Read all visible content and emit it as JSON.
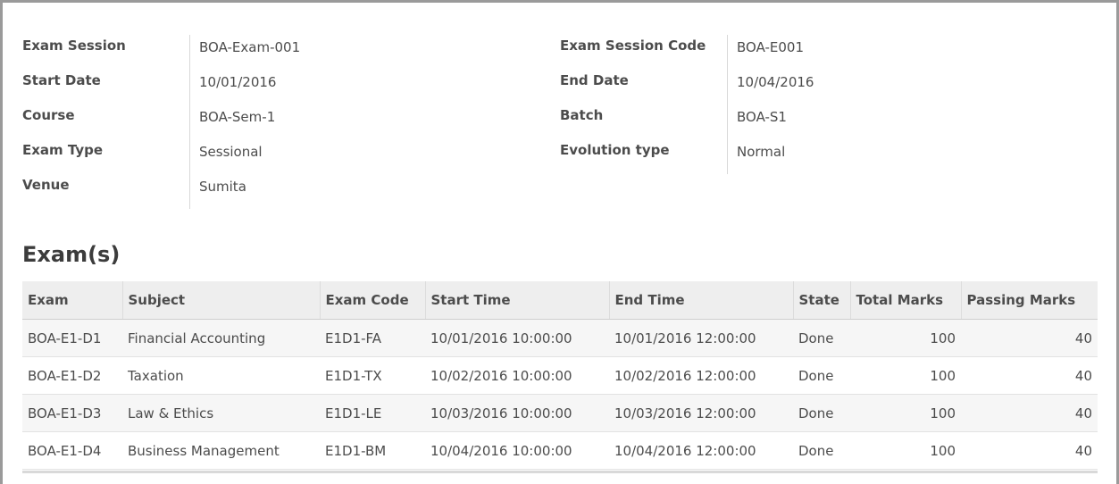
{
  "session": {
    "left": [
      {
        "label": "Exam Session",
        "value": "BOA-Exam-001"
      },
      {
        "label": "Start Date",
        "value": "10/01/2016"
      },
      {
        "label": "Course",
        "value": "BOA-Sem-1"
      },
      {
        "label": "Exam Type",
        "value": "Sessional"
      },
      {
        "label": "Venue",
        "value": "Sumita"
      }
    ],
    "right": [
      {
        "label": "Exam Session Code",
        "value": "BOA-E001"
      },
      {
        "label": "End Date",
        "value": "10/04/2016"
      },
      {
        "label": "Batch",
        "value": "BOA-S1"
      },
      {
        "label": "Evolution type",
        "value": "Normal"
      }
    ]
  },
  "exams": {
    "title": "Exam(s)",
    "columns": [
      "Exam",
      "Subject",
      "Exam Code",
      "Start Time",
      "End Time",
      "State",
      "Total Marks",
      "Passing Marks"
    ],
    "rows": [
      [
        "BOA-E1-D1",
        "Financial Accounting",
        "E1D1-FA",
        "10/01/2016 10:00:00",
        "10/01/2016 12:00:00",
        "Done",
        "100",
        "40"
      ],
      [
        "BOA-E1-D2",
        "Taxation",
        "E1D1-TX",
        "10/02/2016 10:00:00",
        "10/02/2016 12:00:00",
        "Done",
        "100",
        "40"
      ],
      [
        "BOA-E1-D3",
        "Law & Ethics",
        "E1D1-LE",
        "10/03/2016 10:00:00",
        "10/03/2016 12:00:00",
        "Done",
        "100",
        "40"
      ],
      [
        "BOA-E1-D4",
        "Business Management",
        "E1D1-BM",
        "10/04/2016 10:00:00",
        "10/04/2016 12:00:00",
        "Done",
        "100",
        "40"
      ]
    ]
  }
}
